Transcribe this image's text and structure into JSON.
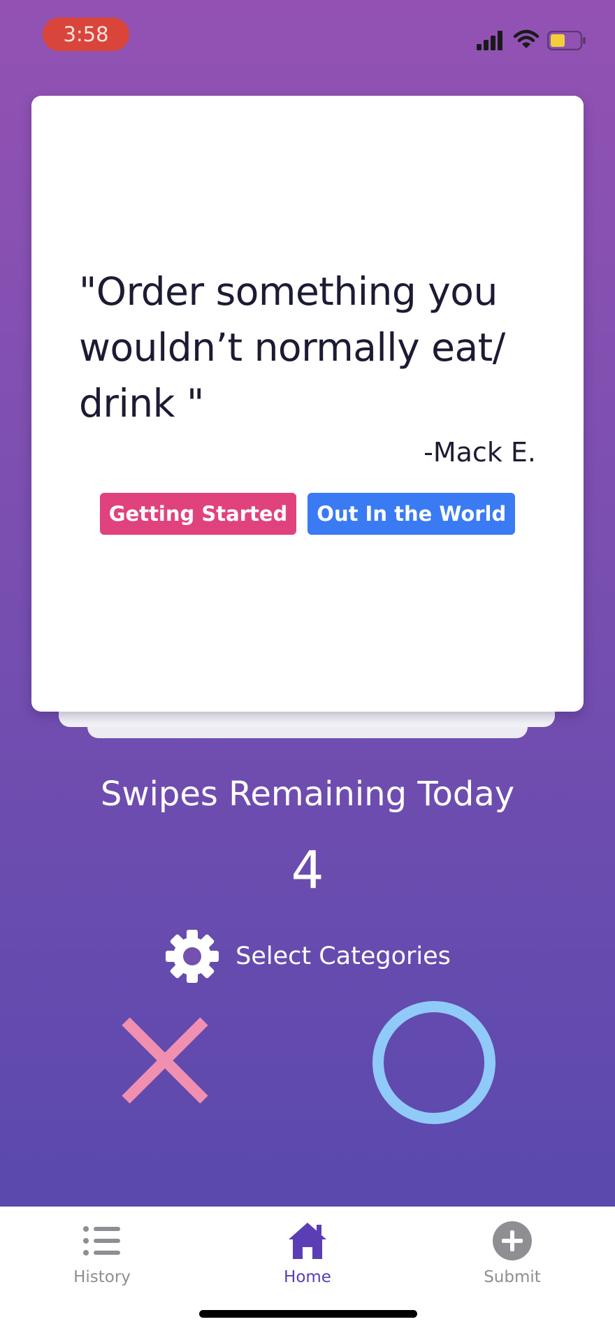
{
  "status_bar": {
    "time": "3:58",
    "icons": [
      "signal-icon",
      "wifi-icon",
      "battery-icon"
    ]
  },
  "card": {
    "quote": "\"Order something you wouldn’t normally eat/ drink \"",
    "author": "-Mack E.",
    "tags": [
      {
        "label": "Getting Started",
        "color": "#e0427e"
      },
      {
        "label": "Out In the World",
        "color": "#3a7bf4"
      }
    ]
  },
  "swipes": {
    "title": "Swipes Remaining Today",
    "count": "4"
  },
  "categories": {
    "label": "Select Categories",
    "icon": "gear-icon"
  },
  "actions": {
    "reject_icon": "x-icon",
    "accept_icon": "circle-icon",
    "reject_color": "#f08fb0",
    "accept_color": "#90caf9"
  },
  "tab_bar": {
    "tabs": [
      {
        "label": "History",
        "icon": "list-icon"
      },
      {
        "label": "Home",
        "icon": "home-icon",
        "active": true
      },
      {
        "label": "Submit",
        "icon": "plus-icon"
      }
    ]
  },
  "colors": {
    "background_top": "#9352b3",
    "background_bottom": "#5b49ae",
    "active_tab": "#5b3db5"
  }
}
